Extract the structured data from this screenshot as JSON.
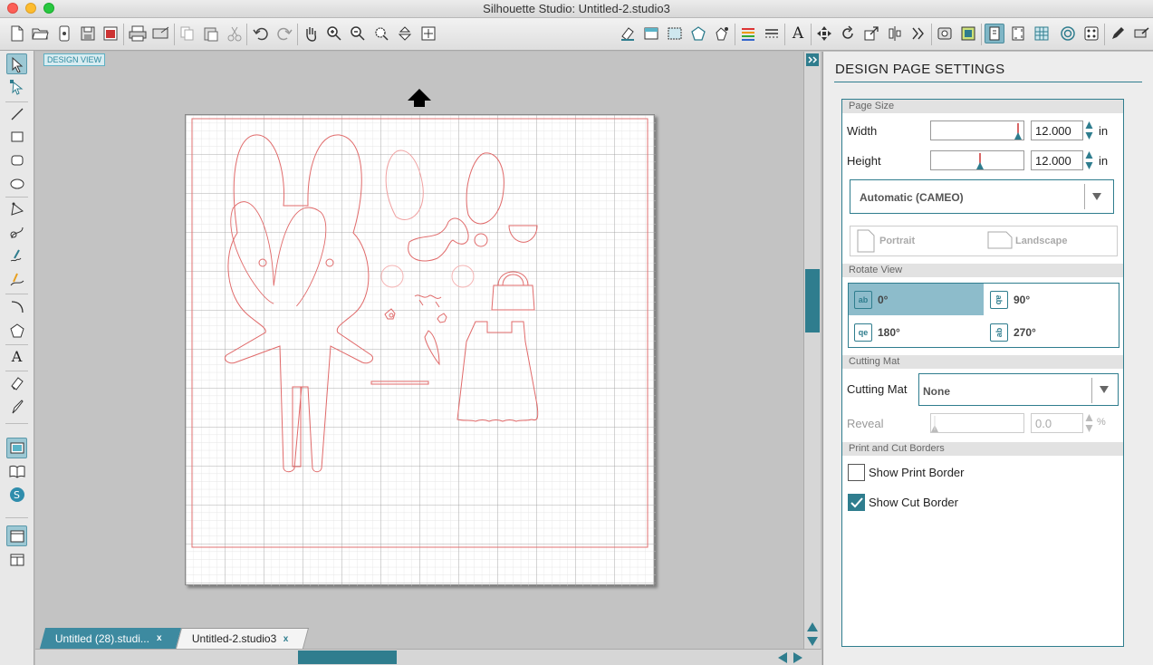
{
  "window": {
    "title": "Silhouette Studio: Untitled-2.studio3"
  },
  "canvas": {
    "design_view_label": "DESIGN VIEW"
  },
  "tabs": [
    {
      "label": "Untitled (28).studi...",
      "close": "x"
    },
    {
      "label": "Untitled-2.studio3",
      "close": "x"
    }
  ],
  "panel": {
    "title": "DESIGN PAGE SETTINGS",
    "page_size": {
      "header": "Page Size",
      "width_label": "Width",
      "width_value": "12.000",
      "height_label": "Height",
      "height_value": "12.000",
      "unit": "in",
      "media": "Automatic (CAMEO)",
      "portrait": "Portrait",
      "landscape": "Landscape"
    },
    "rotate_view": {
      "header": "Rotate View",
      "options": [
        {
          "label": "0°",
          "icon": "ab",
          "selected": true
        },
        {
          "label": "90°",
          "icon": "ab",
          "selected": false
        },
        {
          "label": "180°",
          "icon": "qe",
          "selected": false
        },
        {
          "label": "270°",
          "icon": "ab",
          "selected": false
        }
      ]
    },
    "cutting_mat": {
      "header": "Cutting Mat",
      "label": "Cutting Mat",
      "value": "None",
      "reveal_label": "Reveal",
      "reveal_value": "0.0",
      "reveal_unit": "%"
    },
    "borders": {
      "header": "Print and Cut Borders",
      "show_print_border": "Show Print Border",
      "show_print_border_checked": false,
      "show_cut_border": "Show Cut Border",
      "show_cut_border_checked": true
    }
  },
  "colors": {
    "accent": "#2f7d8e",
    "cut_line": "#e06060",
    "grid": "#c8c8c8"
  }
}
